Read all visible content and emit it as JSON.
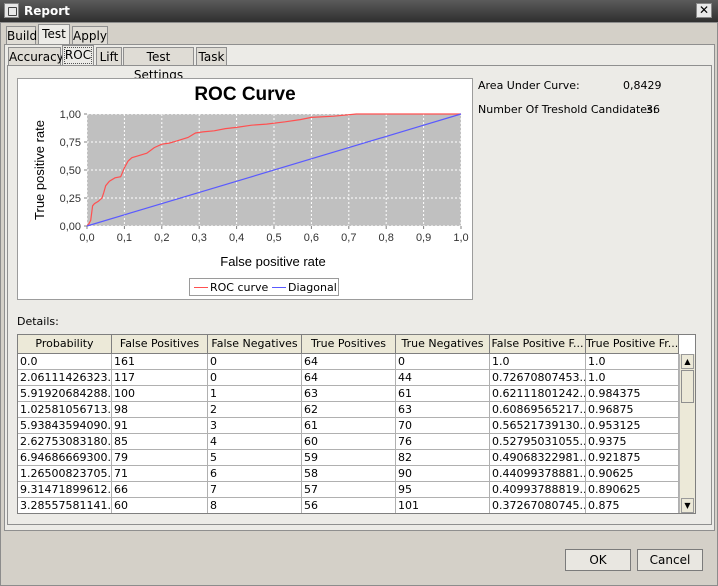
{
  "window": {
    "title": "Report",
    "close_glyph": "✕"
  },
  "tabs_top": [
    {
      "label": "Build"
    },
    {
      "label": "Test"
    },
    {
      "label": "Apply"
    }
  ],
  "tabs_sub": [
    {
      "label": "Accuracy"
    },
    {
      "label": "ROC"
    },
    {
      "label": "Lift"
    },
    {
      "label": "Test Settings"
    },
    {
      "label": "Task"
    }
  ],
  "summary": {
    "auc_label": "Area Under Curve:",
    "auc_value": "0,8429",
    "thresholds_label": "Number Of Treshold Candidates:",
    "thresholds_value": "36"
  },
  "chart_data": {
    "type": "line",
    "title": "ROC Curve",
    "xlabel": "False positive rate",
    "ylabel": "True positive rate",
    "xlim": [
      0,
      1
    ],
    "ylim": [
      0,
      1
    ],
    "x_ticks": [
      "0,0",
      "0,1",
      "0,2",
      "0,3",
      "0,4",
      "0,5",
      "0,6",
      "0,7",
      "0,8",
      "0,9",
      "1,0"
    ],
    "y_ticks": [
      "0,00",
      "0,25",
      "0,50",
      "0,75",
      "1,00"
    ],
    "grid": true,
    "legend_position": "bottom",
    "series": [
      {
        "name": "ROC curve",
        "color": "#ff5050",
        "points": [
          [
            0.0,
            0.0
          ],
          [
            0.005,
            0.02
          ],
          [
            0.01,
            0.05
          ],
          [
            0.015,
            0.18
          ],
          [
            0.02,
            0.2
          ],
          [
            0.03,
            0.22
          ],
          [
            0.04,
            0.25
          ],
          [
            0.045,
            0.3
          ],
          [
            0.05,
            0.36
          ],
          [
            0.06,
            0.4
          ],
          [
            0.075,
            0.43
          ],
          [
            0.09,
            0.44
          ],
          [
            0.1,
            0.52
          ],
          [
            0.11,
            0.58
          ],
          [
            0.12,
            0.61
          ],
          [
            0.14,
            0.63
          ],
          [
            0.16,
            0.65
          ],
          [
            0.18,
            0.7
          ],
          [
            0.2,
            0.73
          ],
          [
            0.22,
            0.74
          ],
          [
            0.24,
            0.76
          ],
          [
            0.27,
            0.79
          ],
          [
            0.29,
            0.83
          ],
          [
            0.31,
            0.84
          ],
          [
            0.34,
            0.85
          ],
          [
            0.37,
            0.87
          ],
          [
            0.4,
            0.88
          ],
          [
            0.44,
            0.9
          ],
          [
            0.48,
            0.91
          ],
          [
            0.53,
            0.93
          ],
          [
            0.57,
            0.95
          ],
          [
            0.6,
            0.97
          ],
          [
            0.66,
            0.98
          ],
          [
            0.72,
            1.0
          ],
          [
            0.85,
            1.0
          ],
          [
            1.0,
            1.0
          ]
        ]
      },
      {
        "name": "Diagonal",
        "color": "#5a5aff",
        "points": [
          [
            0.0,
            0.0
          ],
          [
            1.0,
            1.0
          ]
        ]
      }
    ]
  },
  "details": {
    "label": "Details:",
    "columns": [
      "Probability",
      "False Positives",
      "False Negatives",
      "True Positives",
      "True Negatives",
      "False Positive F...",
      "True Positive Fr..."
    ],
    "rows": [
      [
        "0.0",
        "161",
        "0",
        "64",
        "0",
        "1.0",
        "1.0"
      ],
      [
        "2.06111426323...",
        "117",
        "0",
        "64",
        "44",
        "0.72670807453...",
        "1.0"
      ],
      [
        "5.91920684288...",
        "100",
        "1",
        "63",
        "61",
        "0.62111801242...",
        "0.984375"
      ],
      [
        "1.02581056713...",
        "98",
        "2",
        "62",
        "63",
        "0.60869565217...",
        "0.96875"
      ],
      [
        "5.93843594090...",
        "91",
        "3",
        "61",
        "70",
        "0.56521739130...",
        "0.953125"
      ],
      [
        "2.62753083180...",
        "85",
        "4",
        "60",
        "76",
        "0.52795031055...",
        "0.9375"
      ],
      [
        "6.94686669300...",
        "79",
        "5",
        "59",
        "82",
        "0.49068322981...",
        "0.921875"
      ],
      [
        "1.26500823705...",
        "71",
        "6",
        "58",
        "90",
        "0.44099378881...",
        "0.90625"
      ],
      [
        "9.31471899612...",
        "66",
        "7",
        "57",
        "95",
        "0.40993788819...",
        "0.890625"
      ],
      [
        "3.28557581141...",
        "60",
        "8",
        "56",
        "101",
        "0.37267080745...",
        "0.875"
      ]
    ]
  },
  "buttons": {
    "ok": "OK",
    "cancel": "Cancel"
  },
  "scroll": {
    "up": "▲",
    "down": "▼"
  }
}
